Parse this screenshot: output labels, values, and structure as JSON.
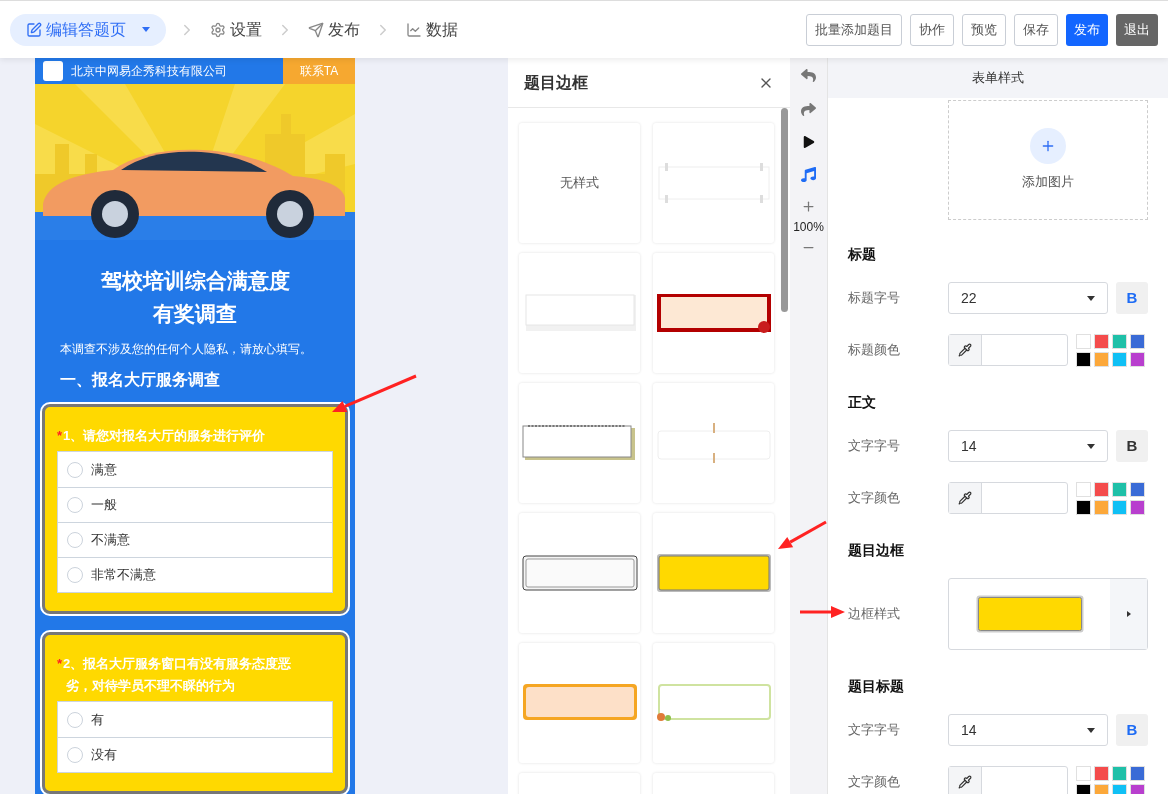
{
  "nav": {
    "steps": [
      {
        "kind": "edit",
        "label": "编辑答题页",
        "selected": true
      },
      {
        "kind": "settings",
        "label": "设置",
        "selected": false
      },
      {
        "kind": "send",
        "label": "发布",
        "selected": false
      },
      {
        "kind": "chart",
        "label": "数据",
        "selected": false
      }
    ]
  },
  "actions": [
    {
      "kind": "outline",
      "label": "批量添加题目"
    },
    {
      "kind": "outline",
      "label": "协作"
    },
    {
      "kind": "outline",
      "label": "预览"
    },
    {
      "kind": "outline",
      "label": "保存"
    },
    {
      "kind": "primary",
      "label": "发布"
    },
    {
      "kind": "dark",
      "label": "退出"
    }
  ],
  "preview": {
    "company": "北京中网易企秀科技有限公司",
    "contact": "联系TA",
    "title_lines": [
      "驾校培训综合满意度",
      "有奖调查"
    ],
    "intro": "本调查不涉及您的任何个人隐私，请放心填写。",
    "section": "一、报名大厅服务调查",
    "questions": [
      {
        "mark": "*",
        "title": "1、请您对报名大厅的服务进行评价",
        "options": [
          {
            "label": "满意",
            "selected": false
          },
          {
            "label": "一般",
            "selected": false
          },
          {
            "label": "不满意",
            "selected": false
          },
          {
            "label": "非常不满意",
            "selected": false
          }
        ]
      },
      {
        "mark": "*",
        "title": "2、报名大厅服务窗口有没有服务态度恶劣，对待学员不理不睬的行为",
        "options": [
          {
            "label": "有",
            "selected": false
          },
          {
            "label": "没有",
            "selected": false
          }
        ]
      }
    ]
  },
  "gallery": {
    "title": "题目边框",
    "cards": [
      {
        "kind": "none",
        "label": "无样式"
      },
      {
        "kind": "clips"
      },
      {
        "kind": "paper"
      },
      {
        "kind": "red"
      },
      {
        "kind": "spiral"
      },
      {
        "kind": "pins"
      },
      {
        "kind": "lace"
      },
      {
        "kind": "yellow"
      },
      {
        "kind": "peach"
      },
      {
        "kind": "leaf"
      },
      {
        "kind": "blank"
      },
      {
        "kind": "blank"
      }
    ]
  },
  "toolbar": {
    "zoom": "100%"
  },
  "settings": {
    "tab": "表单样式",
    "upload": "添加图片",
    "sections": [
      {
        "heading": "标题",
        "rows": [
          {
            "kind": "size",
            "label": "标题字号",
            "value": "22",
            "bold_label": "B",
            "bold": true
          },
          {
            "kind": "color",
            "label": "标题颜色",
            "swatches": [
              {
                "color": "#ffffff"
              },
              {
                "color": "#f44c4c"
              },
              {
                "color": "#1fc0a8"
              },
              {
                "color": "#3a6bd6"
              },
              {
                "color": "#000000"
              },
              {
                "color": "#fca83a"
              },
              {
                "color": "#10c0f5"
              },
              {
                "color": "#b83fce"
              }
            ]
          }
        ]
      },
      {
        "heading": "正文",
        "rows": [
          {
            "kind": "size",
            "label": "文字字号",
            "value": "14",
            "bold_label": "B",
            "bold": false
          },
          {
            "kind": "color",
            "label": "文字颜色",
            "swatches": [
              {
                "color": "#ffffff"
              },
              {
                "color": "#f44c4c"
              },
              {
                "color": "#1fc0a8"
              },
              {
                "color": "#3a6bd6"
              },
              {
                "color": "#000000"
              },
              {
                "color": "#fca83a"
              },
              {
                "color": "#10c0f5"
              },
              {
                "color": "#b83fce"
              }
            ]
          }
        ]
      },
      {
        "heading": "题目边框",
        "rows": [
          {
            "kind": "border",
            "label": "边框样式"
          }
        ]
      },
      {
        "heading": "题目标题",
        "rows": [
          {
            "kind": "size",
            "label": "文字字号",
            "value": "14",
            "bold_label": "B",
            "bold": true
          },
          {
            "kind": "color",
            "label": "文字颜色",
            "swatches": [
              {
                "color": "#ffffff"
              },
              {
                "color": "#f44c4c"
              },
              {
                "color": "#1fc0a8"
              },
              {
                "color": "#3a6bd6"
              },
              {
                "color": "#000000"
              },
              {
                "color": "#fca83a"
              },
              {
                "color": "#10c0f5"
              },
              {
                "color": "#b83fce"
              }
            ]
          }
        ]
      }
    ]
  }
}
